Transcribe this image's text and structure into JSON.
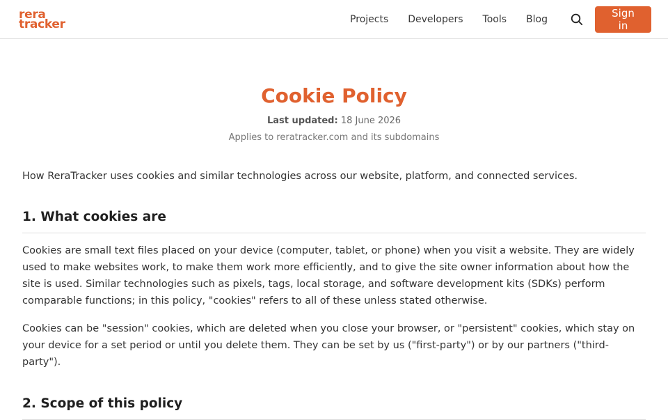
{
  "header": {
    "logo_line1": "rera",
    "logo_line2": "tracker",
    "nav": [
      "Projects",
      "Developers",
      "Tools",
      "Blog"
    ],
    "signin_label": "Sign in"
  },
  "page": {
    "title": "Cookie Policy",
    "updated_label": "Last updated:",
    "updated_date": "18 June 2026",
    "applies": "Applies to reratracker.com and its subdomains",
    "intro": "How ReraTracker uses cookies and similar technologies across our website, platform, and connected services."
  },
  "sections": [
    {
      "heading": "1. What cookies are",
      "paragraphs": [
        "Cookies are small text files placed on your device (computer, tablet, or phone) when you visit a website. They are widely used to make websites work, to make them work more efficiently, and to give the site owner information about how the site is used. Similar technologies such as pixels, tags, local storage, and software development kits (SDKs) perform comparable functions; in this policy, \"cookies\" refers to all of these unless stated otherwise.",
        "Cookies can be \"session\" cookies, which are deleted when you close your browser, or \"persistent\" cookies, which stay on your device for a set period or until you delete them. They can be set by us (\"first-party\") or by our partners (\"third-party\")."
      ]
    },
    {
      "heading": "2. Scope of this policy"
    }
  ],
  "colors": {
    "accent": "#e0612f",
    "text": "#333333",
    "divider": "#dcdcdc"
  },
  "icons": {
    "search": "search-icon"
  }
}
